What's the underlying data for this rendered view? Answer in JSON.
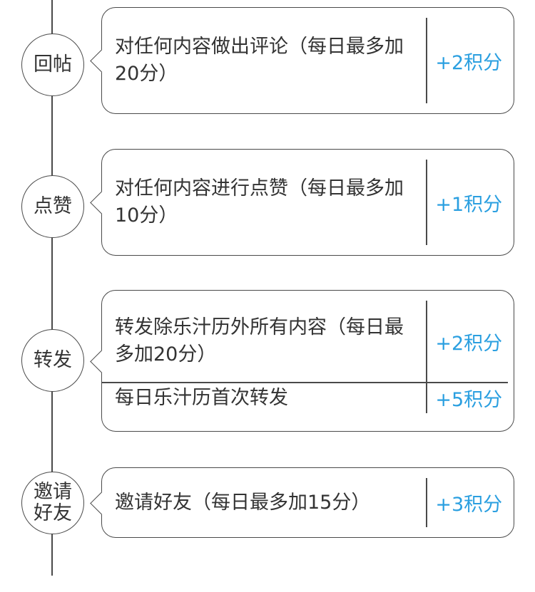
{
  "colors": {
    "accent": "#2a9fe0",
    "line": "#4a4a4a",
    "text": "#333333"
  },
  "items": [
    {
      "label": [
        "回帖"
      ],
      "rows": [
        {
          "text": "对任何内容做出评论（每日最多加20分）",
          "points": "+2积分"
        }
      ]
    },
    {
      "label": [
        "点赞"
      ],
      "rows": [
        {
          "text": "对任何内容进行点赞（每日最多加10分）",
          "points": "+1积分"
        }
      ]
    },
    {
      "label": [
        "转发"
      ],
      "rows": [
        {
          "text": "转发除乐汁历外所有内容（每日最多加20分）",
          "points": "+2积分"
        },
        {
          "text": "每日乐汁历首次转发",
          "points": "+5积分"
        }
      ]
    },
    {
      "label": [
        "邀请",
        "好友"
      ],
      "rows": [
        {
          "text": "邀请好友（每日最多加15分）",
          "points": "+3积分"
        }
      ]
    }
  ]
}
